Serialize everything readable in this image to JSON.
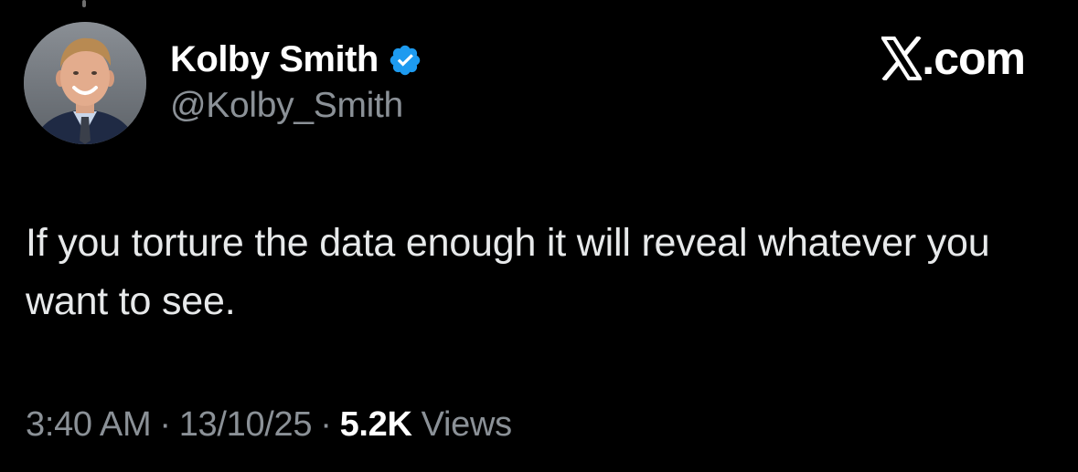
{
  "tweet": {
    "author": {
      "name": "Kolby Smith",
      "handle": "@Kolby_Smith",
      "verified_badge_icon": "verified-check-icon",
      "verified_color": "#1d9bf0"
    },
    "source": {
      "logo_icon": "x-logo-icon",
      "domain_text": ".com"
    },
    "text": "If you torture the data enough it will reveal whatever you want to see.",
    "meta": {
      "time": "3:40 AM",
      "separator": "·",
      "date": "13/10/25",
      "views_count": "5.2K",
      "views_label": "Views"
    }
  },
  "colors": {
    "background": "#000000",
    "primary_text": "#e7e9ea",
    "secondary_text": "#8b9197",
    "accent": "#1d9bf0"
  }
}
